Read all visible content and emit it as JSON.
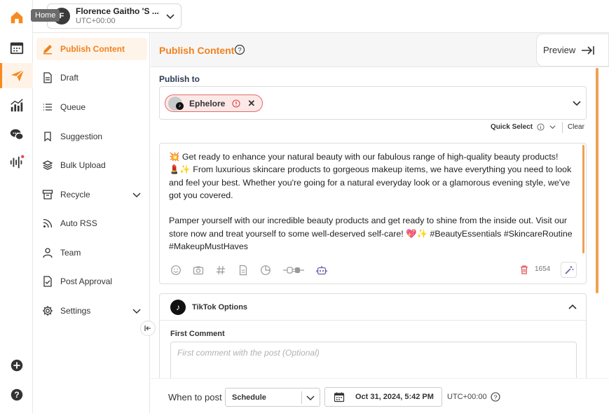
{
  "rail": {
    "tooltip": "Home",
    "items": [
      "home-icon",
      "calendar-icon",
      "publish-icon",
      "analytics-icon",
      "inbox-icon",
      "listening-icon",
      "add-icon",
      "help-icon"
    ],
    "accent": "#f58b1f",
    "notification_dot_color": "#e5484d"
  },
  "account": {
    "avatar_initial": "F",
    "name": "Florence Gaitho 'S ...",
    "timezone": "UTC+00:00"
  },
  "sidebar": {
    "items": [
      {
        "label": "Publish Content",
        "icon": "pen-icon"
      },
      {
        "label": "Draft",
        "icon": "document-icon"
      },
      {
        "label": "Queue",
        "icon": "list-icon"
      },
      {
        "label": "Suggestion",
        "icon": "bookmark-icon"
      },
      {
        "label": "Bulk Upload",
        "icon": "layers-icon"
      },
      {
        "label": "Recycle",
        "icon": "archive-icon"
      },
      {
        "label": "Auto RSS",
        "icon": "rss-icon"
      },
      {
        "label": "Team",
        "icon": "user-icon"
      },
      {
        "label": "Post Approval",
        "icon": "approval-icon"
      },
      {
        "label": "Settings",
        "icon": "gear-icon"
      }
    ]
  },
  "main": {
    "title": "Publish Content",
    "preview_label": "Preview",
    "publish_to_label": "Publish to",
    "selected_account": {
      "name": "Ephelore",
      "platform": "tiktok",
      "status": "warning"
    },
    "quick_select_label": "Quick Select",
    "clear_label": "Clear",
    "post_text_line1": "💥 Get ready to enhance your natural beauty with our fabulous range of high-quality beauty products!",
    "post_text_line2": "💄✨ From luxurious skincare products to gorgeous makeup items, we have everything you need to look and feel your best. Whether you're going for a natural everyday look or a glamorous evening style, we've got you covered.",
    "post_text_line3": "Pamper yourself with our incredible beauty products and get ready to shine from the inside out. Visit our store now and treat yourself to some well-deserved self-care! 💖✨ #BeautyEssentials #SkincareRoutine #MakeupMustHaves",
    "char_count": "1654",
    "tiktok_options_title": "TikTok Options",
    "first_comment_label": "First Comment",
    "first_comment_placeholder": "First comment with the post (Optional)"
  },
  "footer": {
    "when_label": "When to post",
    "schedule_value": "Schedule",
    "date_value": "Oct 31, 2024, 5:42 PM",
    "timezone": "UTC+00:00"
  }
}
